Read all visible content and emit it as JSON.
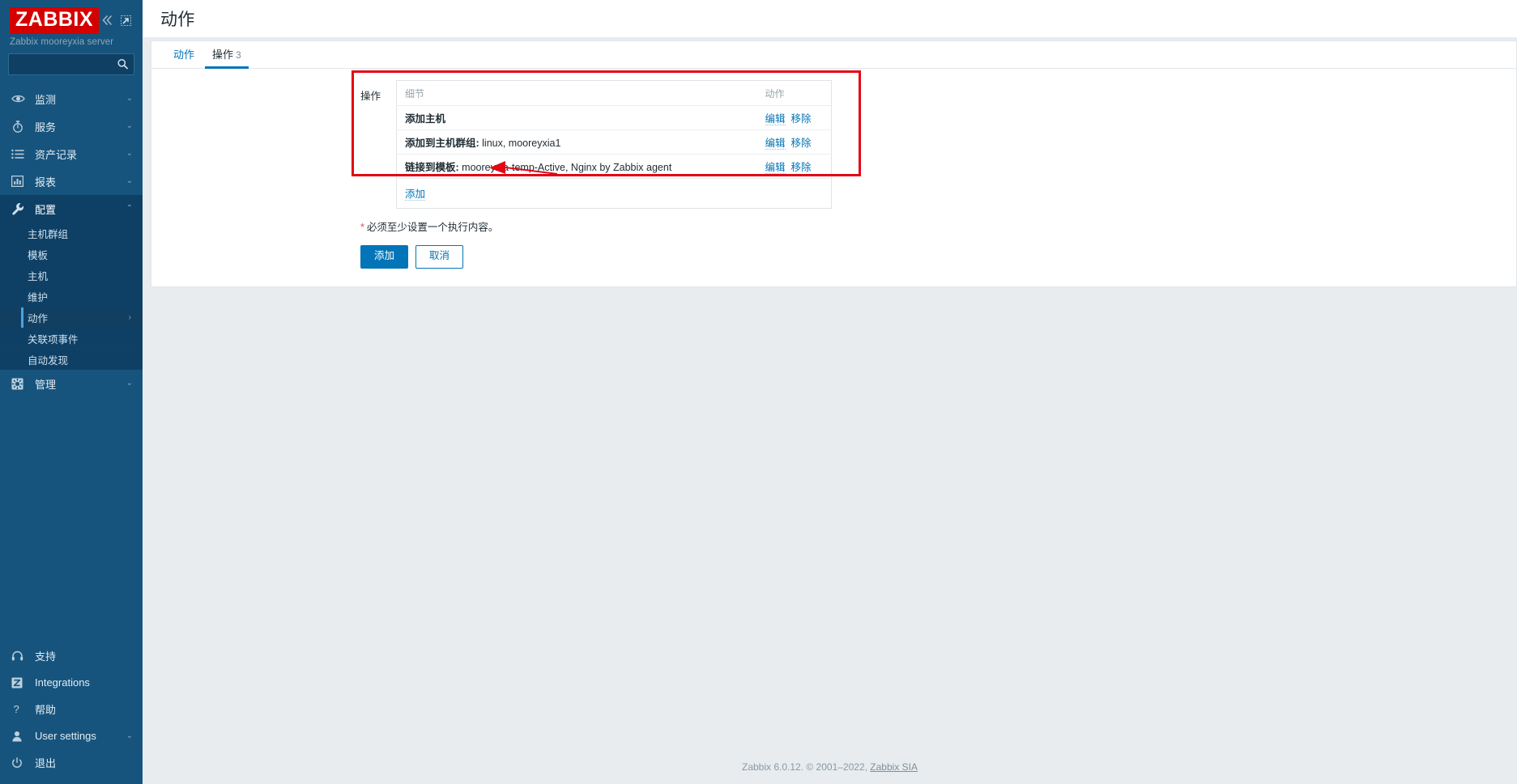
{
  "sidebar": {
    "logo_text": "ZABBIX",
    "server_name": "Zabbix mooreyxia server",
    "collapse_icon": "chevrons-left-icon",
    "hide_icon": "expand-window-icon",
    "search": {
      "value": "",
      "placeholder": ""
    },
    "nav": [
      {
        "label": "监测",
        "icon": "eye-icon",
        "chevron": "chevron-down",
        "state": "collapsed"
      },
      {
        "label": "服务",
        "icon": "stopwatch-icon",
        "chevron": "chevron-down",
        "state": "collapsed"
      },
      {
        "label": "资产记录",
        "icon": "list-icon",
        "chevron": "chevron-down",
        "state": "collapsed"
      },
      {
        "label": "报表",
        "icon": "bar-chart-icon",
        "chevron": "chevron-down",
        "state": "collapsed"
      },
      {
        "label": "配置",
        "icon": "wrench-icon",
        "chevron": "chevron-up",
        "state": "expanded"
      }
    ],
    "sub_nav": [
      {
        "label": "主机群组",
        "active": false,
        "chevron": ""
      },
      {
        "label": "模板",
        "active": false,
        "chevron": ""
      },
      {
        "label": "主机",
        "active": false,
        "chevron": ""
      },
      {
        "label": "维护",
        "active": false,
        "chevron": ""
      },
      {
        "label": "动作",
        "active": true,
        "chevron": "›"
      },
      {
        "label": "关联项事件",
        "active": false,
        "chevron": ""
      },
      {
        "label": "自动发现",
        "active": false,
        "chevron": ""
      }
    ],
    "nav_after": [
      {
        "label": "管理",
        "icon": "gear-icon",
        "chevron": "chevron-down",
        "state": "collapsed"
      }
    ],
    "bottom_nav": [
      {
        "label": "支持",
        "icon": "headset-icon",
        "chevron": ""
      },
      {
        "label": "Integrations",
        "icon": "zabbix-z-icon",
        "chevron": ""
      },
      {
        "label": "帮助",
        "icon": "question-icon",
        "chevron": ""
      },
      {
        "label": "User settings",
        "icon": "user-icon",
        "chevron": "chevron-down"
      },
      {
        "label": "退出",
        "icon": "power-icon",
        "chevron": ""
      }
    ]
  },
  "header": {
    "title": "动作"
  },
  "tabs": [
    {
      "label": "动作",
      "count": "",
      "active": false
    },
    {
      "label": "操作",
      "count": "3",
      "active": true
    }
  ],
  "form": {
    "row_label": "操作",
    "table": {
      "headers": {
        "details": "细节",
        "action": "动作"
      },
      "rows": [
        {
          "name": "添加主机",
          "value": "",
          "edit": "编辑",
          "remove": "移除"
        },
        {
          "name": "添加到主机群组:",
          "value": "linux, mooreyxia1",
          "edit": "编辑",
          "remove": "移除"
        },
        {
          "name": "链接到模板:",
          "value": "mooreyxia-temp-Active, Nginx by Zabbix agent",
          "edit": "编辑",
          "remove": "移除"
        }
      ],
      "add_link": "添加"
    },
    "required_note": "必须至少设置一个执行内容。",
    "required_star": "*",
    "buttons": {
      "submit": "添加",
      "cancel": "取消"
    }
  },
  "annotation": {
    "highlight_color": "#e30613",
    "arrow_color": "#e30613",
    "arrow_name": "red-pointer-arrow"
  },
  "footer": {
    "text": "Zabbix 6.0.12. © 2001–2022, ",
    "link": "Zabbix SIA"
  },
  "colors": {
    "sidebar_bg": "#17547d",
    "accent": "#0275b8",
    "brand_red": "#d40000",
    "page_bg": "#e8ecef"
  }
}
